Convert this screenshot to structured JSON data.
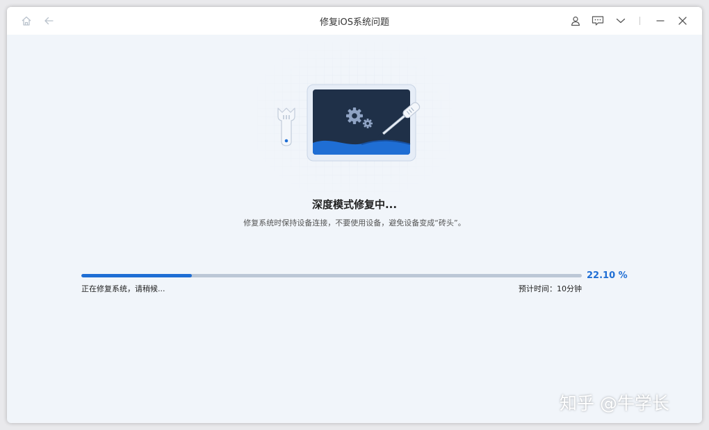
{
  "window": {
    "title": "修复iOS系统问题"
  },
  "titlebar": {
    "icons": [
      "home-icon",
      "back-arrow-icon",
      "user-icon",
      "feedback-icon",
      "chevron-down-icon",
      "minimize-icon",
      "close-icon"
    ]
  },
  "main": {
    "heading": "深度模式修复中...",
    "subheading": "修复系统时保持设备连接，不要使用设备，避免设备变成“砖头”。"
  },
  "progress": {
    "percent": 22.1,
    "percent_label": "22.10 %",
    "status_text": "正在修复系统，请稍候...",
    "eta_text": "预计时间：10分钟"
  },
  "watermark": {
    "text": "知乎 @牛学长"
  },
  "colors": {
    "accent": "#1f6ed4",
    "track": "#bcc7d6",
    "background": "#f1f5fa",
    "screen": "#1f3048"
  }
}
